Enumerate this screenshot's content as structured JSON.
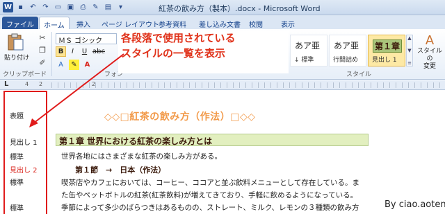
{
  "window": {
    "title": "紅茶の飲み方（製本）.docx - Microsoft Word",
    "qat_icons": [
      "word-icon",
      "save-icon",
      "undo-icon",
      "redo-icon",
      "open-icon",
      "image-icon",
      "print-icon",
      "highlight-icon",
      "layout-icon",
      "qat-menu-icon"
    ]
  },
  "tabs": [
    "ファイル",
    "ホーム",
    "挿入",
    "ページ レイアウト",
    "参考資料",
    "差し込み文書",
    "校閲",
    "表示"
  ],
  "active_tab": "ホーム",
  "ribbon": {
    "clipboard": {
      "paste_label": "貼り付け",
      "group_label": "クリップボード"
    },
    "font": {
      "font_name": "ＭＳ ゴシック",
      "bold": "B",
      "italic": "I",
      "underline": "U",
      "strike": "abc",
      "group_label": "フォン"
    },
    "styles": {
      "group_label": "スタイル",
      "tiles": [
        {
          "sample": "あア亜",
          "name": "↓ 標準"
        },
        {
          "sample": "あア亜",
          "name": "行間詰め"
        },
        {
          "sample": "第１章",
          "name": "見出し 1"
        }
      ],
      "change_styles_label_1": "スタイルの",
      "change_styles_label_2": "変更"
    }
  },
  "callout": {
    "line1": "各段落で使用されている",
    "line2": "スタイルの一覧を表示"
  },
  "ruler": {
    "corner": "L",
    "numbers": [
      "4",
      "2",
      "2"
    ]
  },
  "style_pane": [
    "表題",
    "見出し 1",
    "標準",
    "見出し 2",
    "標準",
    "標準"
  ],
  "document": {
    "title": "◇◇□紅茶の飲み方（作法）□◇◇",
    "heading1": "第１章 世界における紅茶の楽しみ方とは",
    "para1": "世界各地にはさまざまな紅茶の楽しみ方がある。",
    "heading2": "第１節　→　日本（作法）",
    "para2": "喫茶店やカフェにおいては、コーヒー、ココアと並ぶ飲料メニューとして存在している。ま",
    "para3": "た缶やペットボトルの紅茶(紅茶飲料)が増えてきており、手軽に飲めるようになっている。",
    "para4": "季節によって多少のばらつきはあるものの、ストレート、ミルク、レモンの３種類の飲み方"
  },
  "credit": "By ciao.aoten",
  "colors": {
    "callout_text": "#e0321a",
    "pane_border": "#e01b1b",
    "heading1_bg": "#e2efbf",
    "title_text": "#f29a4a"
  }
}
